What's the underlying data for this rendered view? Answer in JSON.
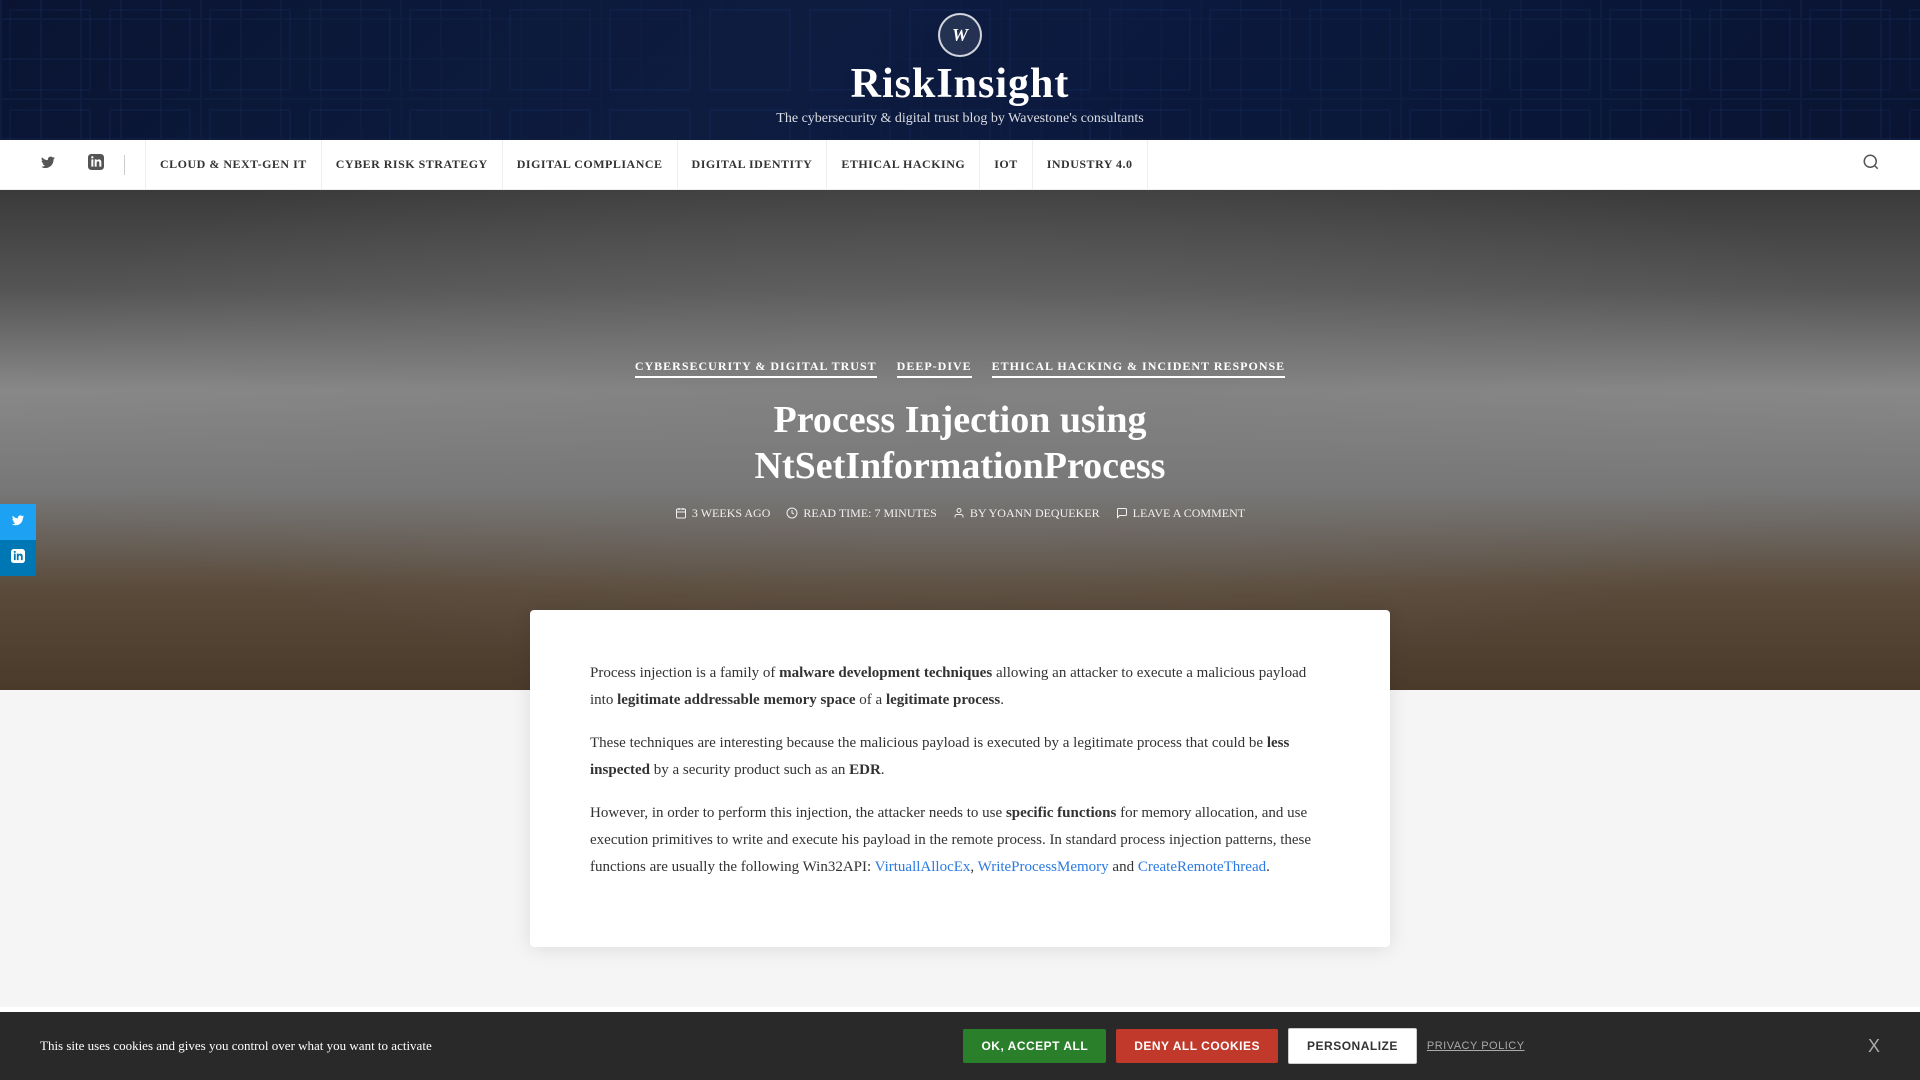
{
  "site": {
    "logo_letter": "W",
    "title": "RiskInsight",
    "subtitle": "The cybersecurity & digital trust blog by Wavestone's consultants"
  },
  "nav": {
    "social": [
      {
        "id": "twitter",
        "label": "Twitter",
        "icon": "twitter-icon"
      },
      {
        "id": "linkedin",
        "label": "LinkedIn",
        "icon": "linkedin-icon"
      }
    ],
    "links": [
      {
        "id": "cloud",
        "label": "CLOUD & NEXT-GEN IT"
      },
      {
        "id": "cyber-risk",
        "label": "CYBER RISK STRATEGY"
      },
      {
        "id": "digital-compliance",
        "label": "DIGITAL COMPLIANCE"
      },
      {
        "id": "digital-identity",
        "label": "DIGITAL IDENTITY"
      },
      {
        "id": "ethical-hacking",
        "label": "ETHICAL HACKING"
      },
      {
        "id": "iot",
        "label": "IOT"
      },
      {
        "id": "industry",
        "label": "INDUSTRY 4.0"
      }
    ],
    "search_icon": "search-icon"
  },
  "hero": {
    "categories": [
      {
        "id": "cybersecurity",
        "label": "CYBERSECURITY & DIGITAL TRUST"
      },
      {
        "id": "deep-dive",
        "label": "DEEP-DIVE"
      },
      {
        "id": "ethical-hacking",
        "label": "ETHICAL HACKING & INCIDENT RESPONSE"
      }
    ],
    "title": "Process Injection using NtSetInformationProcess",
    "meta": {
      "date": "3 WEEKS AGO",
      "read_time": "READ TIME: 7 MINUTES",
      "author": "BY YOANN DEQUEKER",
      "comment": "LEAVE A COMMENT"
    }
  },
  "article": {
    "paragraphs": [
      {
        "id": "p1",
        "parts": [
          {
            "type": "text",
            "content": "Process injection is a family of "
          },
          {
            "type": "bold",
            "content": "malware development techniques"
          },
          {
            "type": "text",
            "content": " allowing an attacker to execute a malicious payload into "
          },
          {
            "type": "bold",
            "content": "legitimate addressable memory space"
          },
          {
            "type": "text",
            "content": " of a "
          },
          {
            "type": "bold",
            "content": "legitimate process"
          },
          {
            "type": "text",
            "content": "."
          }
        ]
      },
      {
        "id": "p2",
        "parts": [
          {
            "type": "text",
            "content": "These techniques are interesting because the malicious payload is executed by a legitimate process that could be "
          },
          {
            "type": "bold",
            "content": "less inspected"
          },
          {
            "type": "text",
            "content": " by a security product such as an "
          },
          {
            "type": "bold",
            "content": "EDR"
          },
          {
            "type": "text",
            "content": "."
          }
        ]
      },
      {
        "id": "p3",
        "parts": [
          {
            "type": "text",
            "content": "However, in order to perform this injection, the attacker needs to use "
          },
          {
            "type": "bold",
            "content": "specific functions"
          },
          {
            "type": "text",
            "content": " for memory allocation, and use execution primitives to write and execute his payload in the remote process. In standard process injection patterns, these functions are usually the following Win32API: "
          },
          {
            "type": "link",
            "content": "VirtuallAllocEx",
            "href": "#"
          },
          {
            "type": "text",
            "content": ", "
          },
          {
            "type": "link",
            "content": "WriteProcessMemory",
            "href": "#"
          },
          {
            "type": "text",
            "content": " and "
          },
          {
            "type": "link",
            "content": "CreateRemoteThread",
            "href": "#"
          },
          {
            "type": "text",
            "content": "."
          }
        ]
      }
    ]
  },
  "social_sidebar": [
    {
      "id": "twitter-share",
      "icon": "twitter-share-icon",
      "network": "twitter"
    },
    {
      "id": "linkedin-share",
      "icon": "linkedin-share-icon",
      "network": "linkedin"
    }
  ],
  "cookie_banner": {
    "message": "This site uses cookies and gives you control over what you want to activate",
    "buttons": {
      "accept": "OK, ACCEPT ALL",
      "deny": "DENY ALL COOKIES",
      "personalize": "PERSONALIZE",
      "privacy": "PRIVACY POLICY"
    },
    "close_label": "X"
  },
  "colors": {
    "accept_btn": "#2a7f2a",
    "deny_btn": "#c0392b",
    "personalize_btn": "#ffffff",
    "nav_bg": "#ffffff",
    "header_bg": "#0a1428",
    "article_link": "#2a7ae2"
  }
}
